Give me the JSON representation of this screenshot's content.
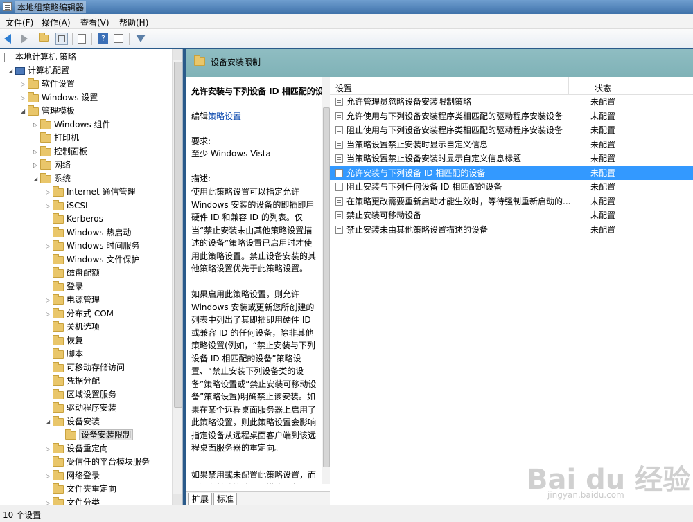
{
  "window": {
    "title": "本地组策略编辑器"
  },
  "menu": [
    "文件(F)",
    "操作(A)",
    "查看(V)",
    "帮助(H)"
  ],
  "tree": {
    "items": [
      {
        "label": "本地计算机 策略",
        "type": "policy",
        "exp": ""
      },
      {
        "label": "计算机配置",
        "type": "computer",
        "exp": "◢"
      },
      {
        "label": "软件设置",
        "type": "folder",
        "exp": "▷"
      },
      {
        "label": "Windows 设置",
        "type": "folder",
        "exp": "▷"
      },
      {
        "label": "管理模板",
        "type": "folder",
        "exp": "◢"
      },
      {
        "label": "Windows 组件",
        "type": "folder",
        "exp": "▷"
      },
      {
        "label": "打印机",
        "type": "folder",
        "exp": ""
      },
      {
        "label": "控制面板",
        "type": "folder",
        "exp": "▷"
      },
      {
        "label": "网络",
        "type": "folder",
        "exp": "▷"
      },
      {
        "label": "系统",
        "type": "folder",
        "exp": "◢"
      },
      {
        "label": "Internet 通信管理",
        "type": "folder",
        "exp": "▷"
      },
      {
        "label": "iSCSI",
        "type": "folder",
        "exp": "▷"
      },
      {
        "label": "Kerberos",
        "type": "folder",
        "exp": ""
      },
      {
        "label": "Windows 热启动",
        "type": "folder",
        "exp": ""
      },
      {
        "label": "Windows 时间服务",
        "type": "folder",
        "exp": "▷"
      },
      {
        "label": "Windows 文件保护",
        "type": "folder",
        "exp": ""
      },
      {
        "label": "磁盘配额",
        "type": "folder",
        "exp": ""
      },
      {
        "label": "登录",
        "type": "folder",
        "exp": ""
      },
      {
        "label": "电源管理",
        "type": "folder",
        "exp": "▷"
      },
      {
        "label": "分布式 COM",
        "type": "folder",
        "exp": "▷"
      },
      {
        "label": "关机选项",
        "type": "folder",
        "exp": ""
      },
      {
        "label": "恢复",
        "type": "folder",
        "exp": ""
      },
      {
        "label": "脚本",
        "type": "folder",
        "exp": ""
      },
      {
        "label": "可移动存储访问",
        "type": "folder",
        "exp": ""
      },
      {
        "label": "凭据分配",
        "type": "folder",
        "exp": ""
      },
      {
        "label": "区域设置服务",
        "type": "folder",
        "exp": ""
      },
      {
        "label": "驱动程序安装",
        "type": "folder",
        "exp": ""
      },
      {
        "label": "设备安装",
        "type": "folder",
        "exp": "◢"
      },
      {
        "label": "设备安装限制",
        "type": "folder",
        "exp": "",
        "selected": true
      },
      {
        "label": "设备重定向",
        "type": "folder",
        "exp": "▷"
      },
      {
        "label": "受信任的平台模块服务",
        "type": "folder",
        "exp": ""
      },
      {
        "label": "网络登录",
        "type": "folder",
        "exp": "▷"
      },
      {
        "label": "文件夹重定向",
        "type": "folder",
        "exp": ""
      },
      {
        "label": "文件分类",
        "type": "folder",
        "exp": "▷"
      }
    ]
  },
  "right": {
    "header_title": "设备安装限制",
    "desc_title": "允许安装与下列设备 ID 相匹配的设备",
    "edit_prefix": "编辑",
    "edit_link": "策略设置",
    "req_label": "要求:",
    "req_value": "至少 Windows Vista",
    "desc_label": "描述:",
    "desc_p1": "使用此策略设置可以指定允许 Windows 安装的设备的即插即用硬件 ID 和兼容 ID 的列表。仅当“禁止安装未由其他策略设置描述的设备”策略设置已启用时才使用此策略设置。禁止设备安装的其他策略设置优先于此策略设置。",
    "desc_p2": "如果启用此策略设置，则允许 Windows 安装或更新您所创建的列表中列出了其即插即用硬件 ID 或兼容 ID 的任何设备，除非其他策略设置(例如，“禁止安装与下列设备 ID 相匹配的设备”策略设置、“禁止安装下列设备类的设备”策略设置或“禁止安装可移动设备”策略设置)明确禁止该安装。如果在某个远程桌面服务器上启用了此策略设置，则此策略设置会影响指定设备从远程桌面客户端到该远程桌面服务器的重定向。",
    "desc_p3": "如果禁用或未配置此策略设置，而且没有其他策略设置描述设备，则",
    "col_setting": "设置",
    "col_state": "状态",
    "rows": [
      {
        "name": "允许管理员忽略设备安装限制策略",
        "state": "未配置"
      },
      {
        "name": "允许使用与下列设备安装程序类相匹配的驱动程序安装设备",
        "state": "未配置"
      },
      {
        "name": "阻止使用与下列设备安装程序类相匹配的驱动程序安装设备",
        "state": "未配置"
      },
      {
        "name": "当策略设置禁止安装时显示自定义信息",
        "state": "未配置"
      },
      {
        "name": "当策略设置禁止设备安装时显示自定义信息标题",
        "state": "未配置"
      },
      {
        "name": "允许安装与下列设备 ID 相匹配的设备",
        "state": "未配置",
        "selected": true
      },
      {
        "name": "阻止安装与下列任何设备 ID 相匹配的设备",
        "state": "未配置"
      },
      {
        "name": "在策略更改需要重新启动才能生效时，等待强制重新启动的...",
        "state": "未配置"
      },
      {
        "name": "禁止安装可移动设备",
        "state": "未配置"
      },
      {
        "name": "禁止安装未由其他策略设置描述的设备",
        "state": "未配置"
      }
    ],
    "tab_expand": "扩展",
    "tab_standard": "标准"
  },
  "status": {
    "text": "10 个设置"
  },
  "watermark": {
    "main": "Bai du 经验",
    "sub": "jingyan.baidu.com"
  }
}
